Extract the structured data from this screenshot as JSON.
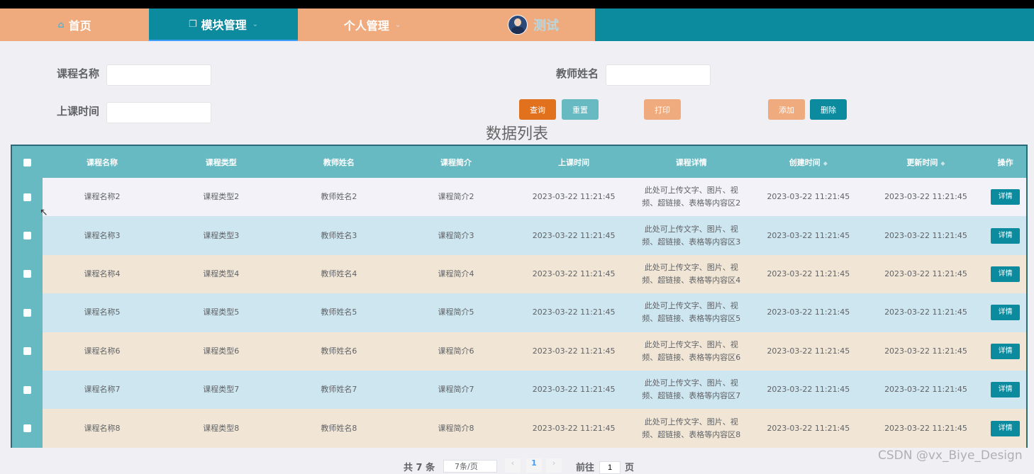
{
  "nav": {
    "home_label": "首页",
    "module_label": "模块管理",
    "personal_label": "个人管理",
    "username": "测试"
  },
  "search": {
    "course_name_label": "课程名称",
    "teacher_name_label": "教师姓名",
    "class_time_label": "上课时间",
    "course_name_value": "",
    "teacher_name_value": "",
    "class_time_value": ""
  },
  "buttons": {
    "query": "查询",
    "reset": "重置",
    "print": "打印",
    "add": "添加",
    "delete": "删除"
  },
  "list_title": "数据列表",
  "table": {
    "headers": [
      "课程名称",
      "课程类型",
      "教师姓名",
      "课程简介",
      "上课时间",
      "课程详情",
      "创建时间",
      "更新时间",
      "操作"
    ],
    "detail_button": "详情",
    "rows": [
      {
        "name": "课程名称2",
        "type": "课程类型2",
        "teacher": "教师姓名2",
        "intro": "课程简介2",
        "class_time": "2023-03-22 11:21:45",
        "detail": "此处可上传文字、图片、视频、超链接、表格等内容区2",
        "created": "2023-03-22 11:21:45",
        "updated": "2023-03-22 11:21:45"
      },
      {
        "name": "课程名称3",
        "type": "课程类型3",
        "teacher": "教师姓名3",
        "intro": "课程简介3",
        "class_time": "2023-03-22 11:21:45",
        "detail": "此处可上传文字、图片、视频、超链接、表格等内容区3",
        "created": "2023-03-22 11:21:45",
        "updated": "2023-03-22 11:21:45"
      },
      {
        "name": "课程名称4",
        "type": "课程类型4",
        "teacher": "教师姓名4",
        "intro": "课程简介4",
        "class_time": "2023-03-22 11:21:45",
        "detail": "此处可上传文字、图片、视频、超链接、表格等内容区4",
        "created": "2023-03-22 11:21:45",
        "updated": "2023-03-22 11:21:45"
      },
      {
        "name": "课程名称5",
        "type": "课程类型5",
        "teacher": "教师姓名5",
        "intro": "课程简介5",
        "class_time": "2023-03-22 11:21:45",
        "detail": "此处可上传文字、图片、视频、超链接、表格等内容区5",
        "created": "2023-03-22 11:21:45",
        "updated": "2023-03-22 11:21:45"
      },
      {
        "name": "课程名称6",
        "type": "课程类型6",
        "teacher": "教师姓名6",
        "intro": "课程简介6",
        "class_time": "2023-03-22 11:21:45",
        "detail": "此处可上传文字、图片、视频、超链接、表格等内容区6",
        "created": "2023-03-22 11:21:45",
        "updated": "2023-03-22 11:21:45"
      },
      {
        "name": "课程名称7",
        "type": "课程类型7",
        "teacher": "教师姓名7",
        "intro": "课程简介7",
        "class_time": "2023-03-22 11:21:45",
        "detail": "此处可上传文字、图片、视频、超链接、表格等内容区7",
        "created": "2023-03-22 11:21:45",
        "updated": "2023-03-22 11:21:45"
      },
      {
        "name": "课程名称8",
        "type": "课程类型8",
        "teacher": "教师姓名8",
        "intro": "课程简介8",
        "class_time": "2023-03-22 11:21:45",
        "detail": "此处可上传文字、图片、视频、超链接、表格等内容区8",
        "created": "2023-03-22 11:21:45",
        "updated": "2023-03-22 11:21:45"
      }
    ]
  },
  "pagination": {
    "total": "共 7 条",
    "page_size": "7条/页",
    "current_page": "1",
    "goto_label": "前往",
    "goto_value": "1",
    "page_suffix": "页"
  },
  "watermark": "CSDN @vx_Biye_Design",
  "colors": {
    "nav_teal": "#0c8a9e",
    "nav_peach": "#efab7e",
    "query_btn": "#e2711d",
    "reset_btn": "#67b9c2",
    "print_btn": "#efab7e",
    "add_btn": "#efab7e",
    "delete_btn": "#0c8a9e",
    "header_bg": "#67b9c2"
  },
  "icons": {
    "home": "home-icon",
    "module": "copy-icon",
    "dropdown": "chevron-down-icon",
    "sort": "sort-icon",
    "cursor": "mouse-pointer-icon"
  }
}
